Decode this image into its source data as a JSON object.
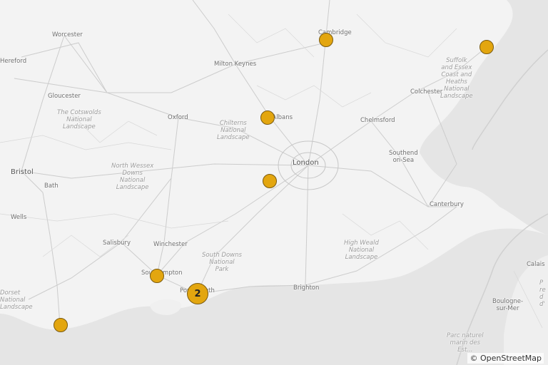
{
  "map": {
    "attribution": "© OpenStreetMap",
    "colors": {
      "land": "#f3f3f3",
      "sea": "#e4e4e4",
      "roads": "#c9c9c9",
      "marker_fill": "#e3a60f",
      "marker_stroke": "#7a5a10"
    },
    "places": {
      "worcester": "Worcester",
      "hereford": "Hereford",
      "milton_keynes": "Milton Keynes",
      "cambridge": "Cambridge",
      "gloucester": "Gloucester",
      "colchester": "Colchester",
      "oxford": "Oxford",
      "st_albans": "St Albans",
      "chelmsford": "Chelmsford",
      "southend": "Southend\non-Sea",
      "bristol": "Bristol",
      "london": "London",
      "bath": "Bath",
      "canterbury": "Canterbury",
      "wells": "Wells",
      "salisbury": "Salisbury",
      "winchester": "Winchester",
      "southampton": "Southampton",
      "portsmouth": "Portsmouth",
      "brighton": "Brighton",
      "calais": "Calais",
      "boulogne": "Boulogne-\nsur-Mer"
    },
    "parks": {
      "cotswolds": "The Cotswolds\nNational\nLandscape",
      "chilterns": "Chilterns\nNational\nLandscape",
      "north_wessex": "North Wessex\nDowns\nNational\nLandscape",
      "south_downs": "South Downs\nNational\nPark",
      "high_weald": "High Weald\nNational\nLandscape",
      "suffolk": "Suffolk\nand Essex\nCoast and\nHeaths\nNational\nLandscape",
      "dorset": "Dorset\nNational\nLandscape",
      "parc_naturel": "Parc naturel\nmarin des\nEst...",
      "right_edge": "P\nre\nd\nd'"
    },
    "markers": [
      {
        "id": "cambridge",
        "count": ""
      },
      {
        "id": "suffolk-coast",
        "count": ""
      },
      {
        "id": "st-albans",
        "count": ""
      },
      {
        "id": "west-london",
        "count": ""
      },
      {
        "id": "southampton",
        "count": ""
      },
      {
        "id": "portsmouth-cluster",
        "count": "2"
      },
      {
        "id": "dorset",
        "count": ""
      }
    ]
  }
}
